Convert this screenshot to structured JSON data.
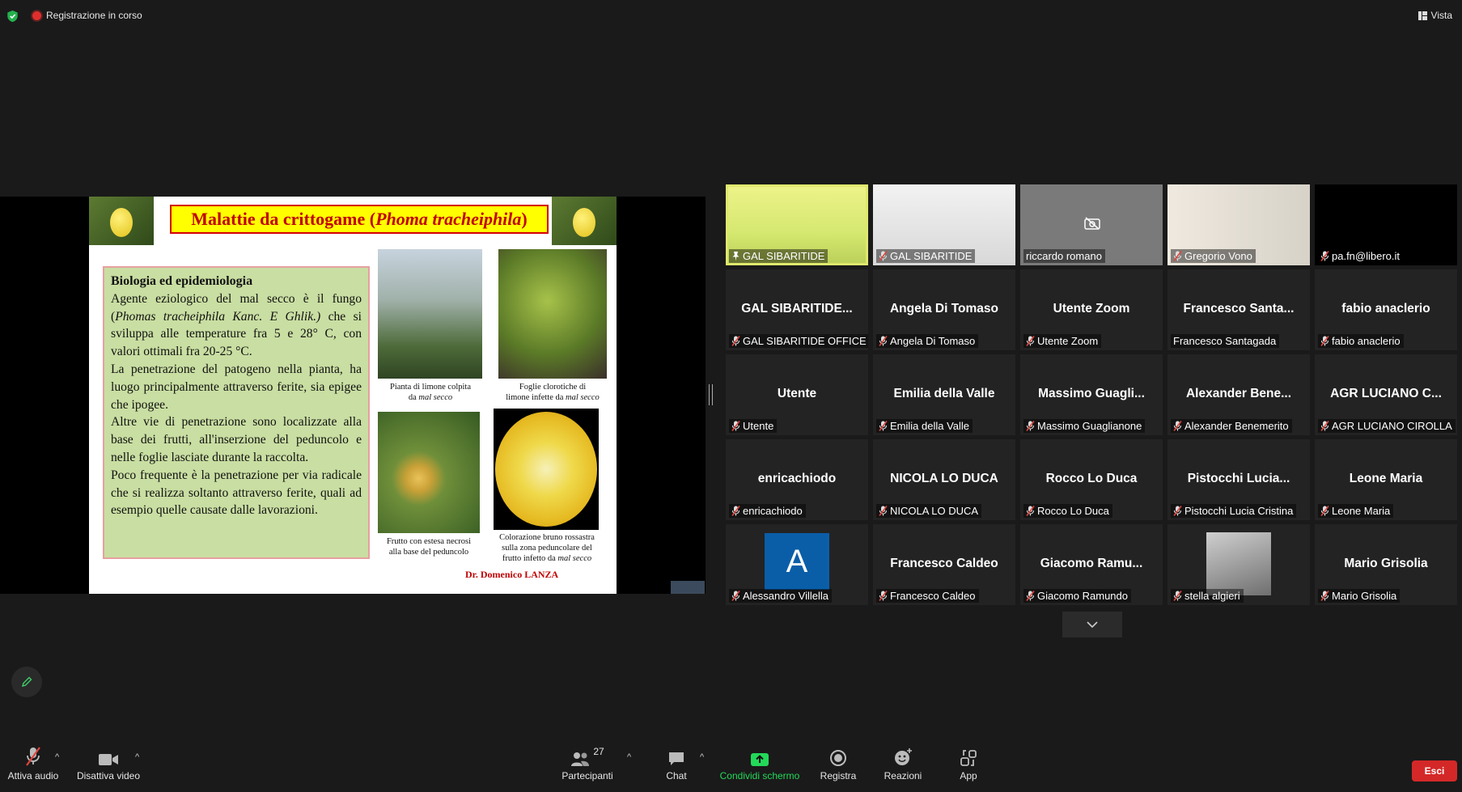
{
  "topbar": {
    "recording": "Registrazione in corso",
    "view": "Vista"
  },
  "slide": {
    "title_plain": "Malattie da crittogame (",
    "title_italic": "Phoma tracheiphila",
    "title_close": ")",
    "heading": "Biologia ed epidemiologia",
    "p1a": "Agente eziologico del mal secco è il fungo (",
    "p1b": "Phomas tracheiphila  Kanc. E Ghlik.)",
    "p1c": " che si sviluppa alle temperature fra 5 e 28° C, con valori ottimali fra 20-25 °C.",
    "p2": "La penetrazione del patogeno nella pianta, ha luogo principalmente attraverso ferite, sia epigee che ipogee.",
    "p3": "Altre vie di penetrazione sono localizzate alla base dei frutti, all'inserzione del peduncolo e nelle foglie lasciate durante la raccolta.",
    "p4": "Poco frequente è la penetrazione per via radicale che si realizza soltanto attraverso ferite, quali ad esempio quelle causate dalle lavorazioni.",
    "cap1a": "Pianta di limone colpita",
    "cap1b": "da ",
    "cap1c": "mal secco",
    "cap2a": "Foglie clorotiche  di",
    "cap2b": "limone infette da ",
    "cap2c": "mal secco",
    "cap3a": "Frutto con estesa necrosi",
    "cap3b": "alla base  del peduncolo",
    "cap4a": "Colorazione bruno rossastra",
    "cap4b": "sulla zona peduncolare del",
    "cap4c": "frutto infetto da ",
    "cap4d": "mal secco",
    "author": "Dr. Domenico LANZA"
  },
  "participants": [
    {
      "label": "GAL SIBARITIDE",
      "big": "",
      "video": "green",
      "muted": false,
      "active": true
    },
    {
      "label": "GAL SIBARITIDE",
      "big": "",
      "video": "room",
      "muted": true
    },
    {
      "label": "riccardo romano",
      "big": "",
      "video": "grey",
      "muted": false
    },
    {
      "label": "Gregorio Vono",
      "big": "",
      "video": "home",
      "muted": true
    },
    {
      "label": "pa.fn@libero.it",
      "big": "",
      "video": "black",
      "muted": true
    },
    {
      "label": "GAL SIBARITIDE OFFICE",
      "big": "GAL SIBARITIDE...",
      "muted": true
    },
    {
      "label": "Angela Di Tomaso",
      "big": "Angela Di Tomaso",
      "muted": true
    },
    {
      "label": "Utente Zoom",
      "big": "Utente Zoom",
      "muted": true
    },
    {
      "label": "Francesco Santagada",
      "big": "Francesco  Santa...",
      "muted": false
    },
    {
      "label": "fabio anaclerio",
      "big": "fabio anaclerio",
      "muted": true
    },
    {
      "label": "Utente",
      "big": "Utente",
      "muted": true
    },
    {
      "label": "Emilia della Valle",
      "big": "Emilia della Valle",
      "muted": true
    },
    {
      "label": "Massimo Guaglianone",
      "big": "Massimo  Guagli...",
      "muted": true
    },
    {
      "label": "Alexander Benemerito",
      "big": "Alexander  Bene...",
      "muted": true
    },
    {
      "label": "AGR LUCIANO CIROLLA",
      "big": "AGR LUCIANO C...",
      "muted": true
    },
    {
      "label": "enricachiodo",
      "big": "enricachiodo",
      "muted": true
    },
    {
      "label": "NICOLA LO DUCA",
      "big": "NICOLA LO DUCA",
      "muted": true
    },
    {
      "label": "Rocco Lo Duca",
      "big": "Rocco Lo Duca",
      "muted": true
    },
    {
      "label": "Pistocchi Lucia Cristina",
      "big": "Pistocchi  Lucia...",
      "muted": true
    },
    {
      "label": "Leone Maria",
      "big": "Leone Maria",
      "muted": true
    },
    {
      "label": "Alessandro Villella",
      "big": "",
      "avatar": "A",
      "muted": true
    },
    {
      "label": "Francesco Caldeo",
      "big": "Francesco Caldeo",
      "muted": true
    },
    {
      "label": "Giacomo Ramundo",
      "big": "Giacomo  Ramu...",
      "muted": true
    },
    {
      "label": "stella algieri",
      "big": "",
      "avatar": "photo",
      "muted": true
    },
    {
      "label": "Mario Grisolia",
      "big": "Mario Grisolia",
      "muted": true
    }
  ],
  "toolbar": {
    "audio": "Attiva audio",
    "video": "Disattiva video",
    "participants": "Partecipanti",
    "participants_count": "27",
    "chat": "Chat",
    "share": "Condividi schermo",
    "record": "Registra",
    "reactions": "Reazioni",
    "apps": "App",
    "leave": "Esci"
  },
  "colors": {
    "share_green": "#23d959",
    "leave_red": "#d42828",
    "active_speaker": "#e0e86d",
    "mute_red": "#e0443e"
  }
}
